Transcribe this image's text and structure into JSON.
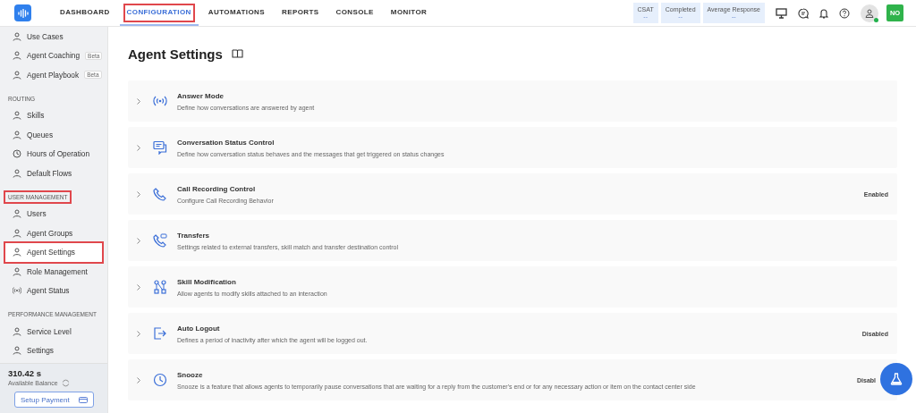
{
  "nav": {
    "tabs": [
      {
        "label": "DASHBOARD",
        "selected": false,
        "highlighted": false
      },
      {
        "label": "CONFIGURATION",
        "selected": true,
        "highlighted": true
      },
      {
        "label": "AUTOMATIONS",
        "selected": false,
        "highlighted": false
      },
      {
        "label": "REPORTS",
        "selected": false,
        "highlighted": false
      },
      {
        "label": "CONSOLE",
        "selected": false,
        "highlighted": false
      },
      {
        "label": "MONITOR",
        "selected": false,
        "highlighted": false
      }
    ],
    "stats": [
      {
        "label": "CSAT",
        "value": "--"
      },
      {
        "label": "Completed",
        "value": "--"
      },
      {
        "label": "Average Response",
        "value": "--"
      }
    ],
    "user_initials": "NO"
  },
  "sidebar": {
    "sections": [
      {
        "items": [
          {
            "label": "Use Cases",
            "selected": false,
            "highlighted": false
          },
          {
            "label": "Agent Coaching",
            "badge": "Beta",
            "selected": false,
            "highlighted": false
          },
          {
            "label": "Agent Playbook",
            "badge": "Beta",
            "selected": false,
            "highlighted": false
          }
        ]
      },
      {
        "heading": "ROUTING",
        "highlighted": false,
        "items": [
          {
            "label": "Skills",
            "selected": false,
            "highlighted": false
          },
          {
            "label": "Queues",
            "selected": false,
            "highlighted": false
          },
          {
            "label": "Hours of Operation",
            "selected": false,
            "highlighted": false
          },
          {
            "label": "Default Flows",
            "selected": false,
            "highlighted": false
          }
        ]
      },
      {
        "heading": "USER MANAGEMENT",
        "highlighted": true,
        "items": [
          {
            "label": "Users",
            "selected": false,
            "highlighted": false
          },
          {
            "label": "Agent Groups",
            "selected": false,
            "highlighted": false
          },
          {
            "label": "Agent Settings",
            "selected": true,
            "highlighted": true
          },
          {
            "label": "Role Management",
            "selected": false,
            "highlighted": false
          },
          {
            "label": "Agent Status",
            "selected": false,
            "highlighted": false
          }
        ]
      },
      {
        "heading": "PERFORMANCE MANAGEMENT",
        "highlighted": false,
        "items": [
          {
            "label": "Service Level",
            "selected": false,
            "highlighted": false
          },
          {
            "label": "Settings",
            "selected": false,
            "highlighted": false
          }
        ]
      }
    ],
    "balance": {
      "amount": "310.42 s",
      "label": "Available Balance",
      "button": "Setup Payment"
    }
  },
  "page": {
    "title": "Agent Settings",
    "settings": [
      {
        "title": "Answer Mode",
        "description": "Define how conversations are answered by agent"
      },
      {
        "title": "Conversation Status Control",
        "description": "Define how conversation status behaves and the messages that get triggered on status changes"
      },
      {
        "title": "Call Recording Control",
        "description": "Configure Call Recording Behavior",
        "status": "Enabled"
      },
      {
        "title": "Transfers",
        "description": "Settings related to external transfers, skill match and transfer destination control"
      },
      {
        "title": "Skill Modification",
        "description": "Allow agents to modify skills attached to an interaction"
      },
      {
        "title": "Auto Logout",
        "description": "Defines a period of inactivity after which the agent will be logged out.",
        "status": "Disabled"
      },
      {
        "title": "Snooze",
        "description": "Snooze is a feature that allows agents to temporarily pause conversations that are waiting for a reply from the customer's end or for any necessary action or item on the contact center side",
        "status": "Disabl"
      }
    ]
  }
}
